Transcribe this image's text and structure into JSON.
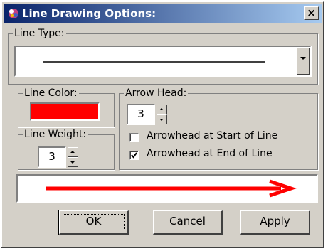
{
  "dialog": {
    "title": "Line Drawing Options:",
    "close_label": "×"
  },
  "line_type": {
    "label": "Line Type:",
    "selected": "solid"
  },
  "line_color": {
    "label": "Line Color:",
    "color": "#ff0000"
  },
  "line_weight": {
    "label": "Line Weight:",
    "value": "3"
  },
  "arrow_head": {
    "label": "Arrow Head:",
    "value": "3",
    "start": {
      "label": "Arrowhead at Start of Line",
      "checked": false
    },
    "end": {
      "label": "Arrowhead at End of Line",
      "checked": true
    }
  },
  "preview": {
    "line_color": "#ff0000"
  },
  "buttons": {
    "ok": "OK",
    "cancel": "Cancel",
    "apply": "Apply"
  },
  "icons": {
    "app": "line-drawing-app-icon",
    "close": "close-icon"
  }
}
